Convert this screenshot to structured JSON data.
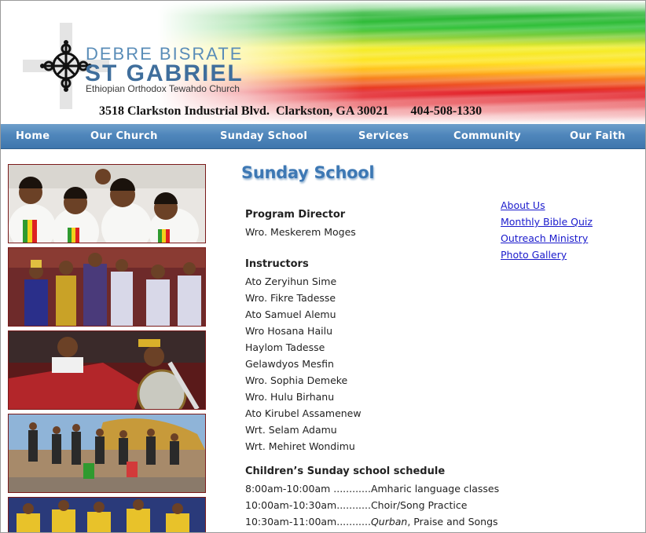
{
  "header": {
    "name_line1": "DEBRE BISRATE",
    "name_line2": "ST GABRIEL",
    "name_line3": "Ethiopian Orthodox Tewahdo Church",
    "address": "3518 Clarkston Industrial Blvd.  Clarkston, GA 30021       404-508-1330",
    "logo_icon": "ethiopian-cross-icon",
    "flag_colors": [
      "#2bb535",
      "#ffe324",
      "#e21d24"
    ]
  },
  "nav": {
    "items": [
      {
        "label": "Home"
      },
      {
        "label": "Our Church"
      },
      {
        "label": "Sunday School"
      },
      {
        "label": "Services"
      },
      {
        "label": "Community"
      },
      {
        "label": "Our Faith"
      }
    ]
  },
  "main": {
    "title": "Sunday School",
    "director_heading": "Program Director",
    "director_name": "Wro. Meskerem Moges",
    "instructors_heading": "Instructors",
    "instructors": [
      "Ato Zeryihun Sime",
      "Wro. Fikre Tadesse",
      "Ato Samuel Alemu",
      "Wro Hosana Hailu",
      "Haylom Tadesse",
      "Gelawdyos Mesfin",
      "Wro. Sophia Demeke",
      "Wro. Hulu Birhanu",
      "Ato Kirubel Assamenew",
      "Wrt. Selam Adamu",
      "Wrt. Mehiret Wondimu"
    ],
    "schedule_heading": "Children’s Sunday school schedule",
    "schedule": [
      {
        "time": "8:00am-10:00am ............",
        "activity": "Amharic language classes",
        "italic": ""
      },
      {
        "time": "10:00am-10:30am...........",
        "activity": "Choir/Song Practice",
        "italic": ""
      },
      {
        "time": "10:30am-11:00am...........",
        "italic": "Qurban",
        "activity": ", Praise and Songs"
      }
    ]
  },
  "sidebar_links": [
    "About Us",
    "Monthly Bible Quiz",
    "Outreach Ministry",
    "Photo Gallery"
  ],
  "photos": [
    {
      "name": "children-in-white-photo"
    },
    {
      "name": "nativity-play-photo"
    },
    {
      "name": "child-with-crown-photo"
    },
    {
      "name": "group-outdoors-photo"
    },
    {
      "name": "choir-children-photo"
    }
  ],
  "colors": {
    "nav_bg": "#4f86bb",
    "title": "#3d78b4",
    "link": "#1a1acc",
    "photo_border": "#7a1a1a"
  }
}
